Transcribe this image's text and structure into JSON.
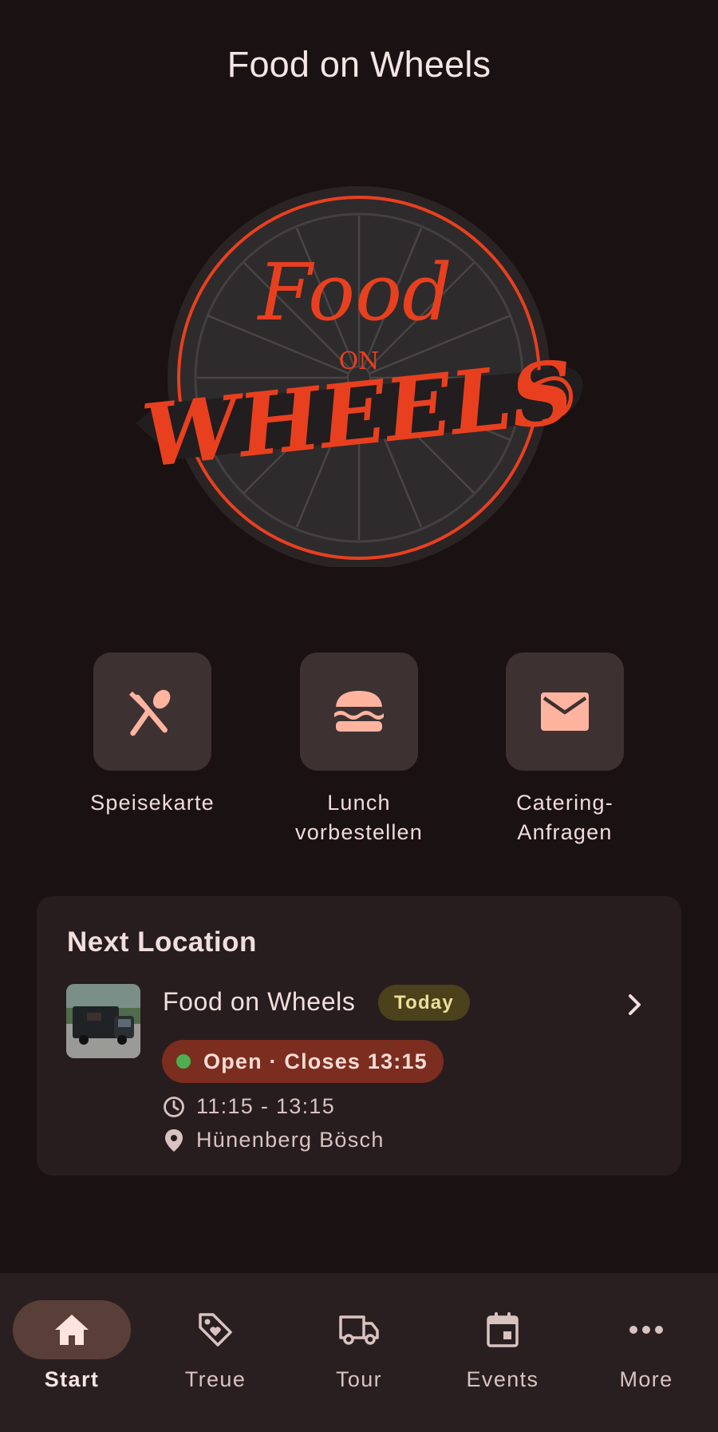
{
  "header": {
    "title": "Food on Wheels"
  },
  "logo": {
    "line1": "Food",
    "line2": "ON",
    "line3": "WHEELS"
  },
  "actions": [
    {
      "label": "Speisekarte",
      "icon": "utensils-icon"
    },
    {
      "label": "Lunch\nvorbestellen",
      "icon": "burger-icon"
    },
    {
      "label": "Catering-\nAnfragen",
      "icon": "mail-icon"
    }
  ],
  "next_location": {
    "title": "Next Location",
    "name": "Food on Wheels",
    "badge": "Today",
    "status": "Open · Closes 13:15",
    "hours": "11:15 - 13:15",
    "place": "Hünenberg Bösch"
  },
  "nav": [
    {
      "label": "Start",
      "icon": "home-icon",
      "active": true
    },
    {
      "label": "Treue",
      "icon": "tag-icon",
      "active": false
    },
    {
      "label": "Tour",
      "icon": "truck-icon",
      "active": false
    },
    {
      "label": "Events",
      "icon": "calendar-icon",
      "active": false
    },
    {
      "label": "More",
      "icon": "more-icon",
      "active": false
    }
  ],
  "colors": {
    "background": "#1a1112",
    "accent": "#ffb4a0",
    "logo_red": "#e8401f",
    "status_green": "#4caf50"
  }
}
